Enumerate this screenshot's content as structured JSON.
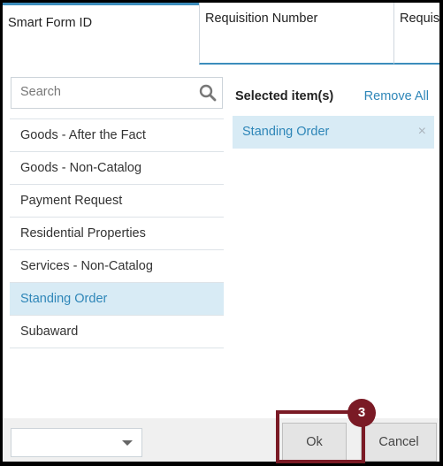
{
  "tabs": [
    {
      "label": "Smart Form ID"
    },
    {
      "label": "Requisition Number"
    },
    {
      "label": "Requisi"
    }
  ],
  "search": {
    "placeholder": "Search"
  },
  "items": [
    {
      "label": "Goods - After the Fact"
    },
    {
      "label": "Goods - Non-Catalog"
    },
    {
      "label": "Payment Request"
    },
    {
      "label": "Residential Properties"
    },
    {
      "label": "Services - Non-Catalog"
    },
    {
      "label": "Standing Order"
    },
    {
      "label": "Subaward"
    }
  ],
  "selected_panel": {
    "title": "Selected item(s)",
    "remove_all": "Remove All",
    "items": [
      {
        "label": "Standing Order",
        "remove": "×"
      }
    ]
  },
  "footer": {
    "select_value": "",
    "ok_label": "Ok",
    "cancel_label": "Cancel"
  },
  "annotation": {
    "step": "3"
  },
  "colors": {
    "accent": "#3c8dbc",
    "selected_bg": "#d8ebf5",
    "annotation": "#7a1a25"
  }
}
